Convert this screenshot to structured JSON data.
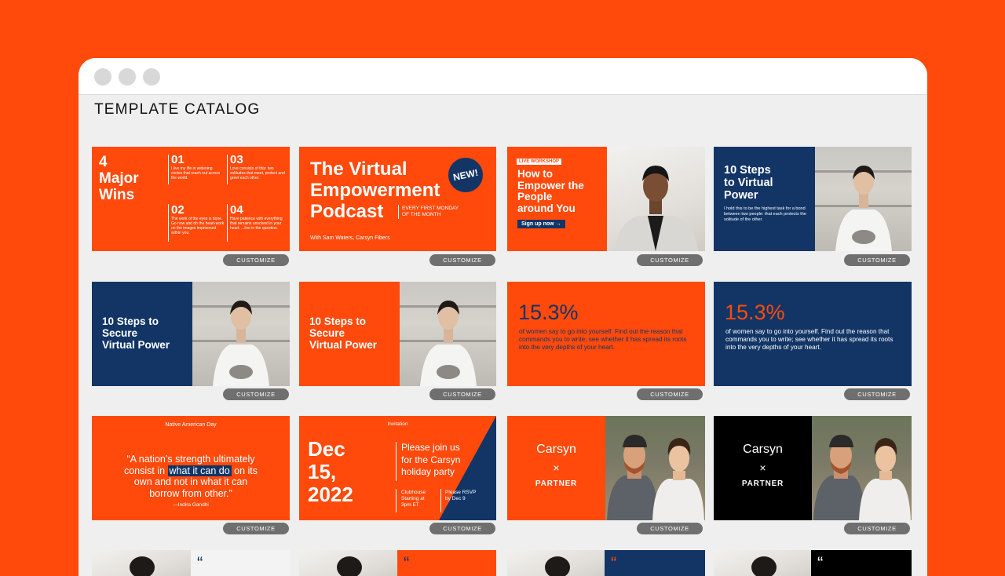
{
  "catalog": {
    "title": "TEMPLATE CATALOG"
  },
  "button_label": "CUSTOMIZE",
  "colors": {
    "orange": "#ff4a0c",
    "navy": "#123566",
    "black": "#000000",
    "button": "#6f6f6f"
  },
  "cards": {
    "wins": {
      "title_line1": "4",
      "title_line2": "Major",
      "title_line3": "Wins",
      "items": [
        {
          "num": "01",
          "text": "I live my life in widening circles that reach out across the world."
        },
        {
          "num": "03",
          "text": "Love consists of this: two solitudes that meet, protect and greet each other."
        },
        {
          "num": "02",
          "text": "The work of the eyes is done. Go now and do the heart-work on the images imprisoned within you."
        },
        {
          "num": "04",
          "text": "Have patience with everything that remains unsolved in your heart. ...live in the question."
        }
      ]
    },
    "podcast": {
      "title_line1": "The Virtual",
      "title_line2": "Empowerment",
      "title_line3": "Podcast",
      "badge": "NEW!",
      "schedule_line1": "EVERY FIRST MONDAY",
      "schedule_line2": "OF THE MONTH",
      "hosts": "With Sam Waters, Carsyn Fibers"
    },
    "workshop": {
      "tag": "LIVE WORKSHOP",
      "title_line1": "How to",
      "title_line2": "Empower the",
      "title_line3": "People",
      "title_line4": "around You",
      "cta": "Sign up now →"
    },
    "steps_navy_a": {
      "title_line1": "10 Steps",
      "title_line2": "to Virtual",
      "title_line3": "Power",
      "body": "I hold this to be the highest task for a bond between two people: that each protects the solitude of the other."
    },
    "steps_navy_b": {
      "title_line1": "10 Steps to",
      "title_line2": "Secure",
      "title_line3": "Virtual Power"
    },
    "steps_orange": {
      "title_line1": "10 Steps to",
      "title_line2": "Secure",
      "title_line3": "Virtual Power"
    },
    "stat_orange": {
      "value": "15.3%",
      "body": "of women say to go into yourself. Find out the reason that commands you to write; see whether it has spread its roots into the very depths of your heart."
    },
    "stat_navy": {
      "value": "15.3%",
      "body": "of women say to go into yourself. Find out the reason that commands you to write; see whether it has spread its roots into the very depths of your heart."
    },
    "quote": {
      "header": "Native American Day",
      "line1": "“A nation’s strength ultimately",
      "line2_pre": "consist in",
      "line2_highlight": "what it can do",
      "line2_post": "on its",
      "line3": "own and not in what it can",
      "line4": "borrow from other.”",
      "author": "—Indira Gandhi"
    },
    "invitation": {
      "header": "Invitation",
      "date_line1": "Dec",
      "date_line2": "15,",
      "date_line3": "2022",
      "message_line1": "Please join us",
      "message_line2": "for the Carsyn",
      "message_line3": "holiday party",
      "place_line1": "Clubhouse",
      "place_line2": "Starting at",
      "place_line3": "3pm ET",
      "rsvp_line1": "Please RSVP",
      "rsvp_line2": "by Dec 9"
    },
    "partner_orange": {
      "name": "Carsyn",
      "x": "×",
      "partner": "PARTNER"
    },
    "partner_black": {
      "name": "Carsyn",
      "x": "×",
      "partner": "PARTNER"
    }
  },
  "icons": [
    "window-dot-icon",
    "person-photo-icon",
    "quote-mark-icon"
  ]
}
